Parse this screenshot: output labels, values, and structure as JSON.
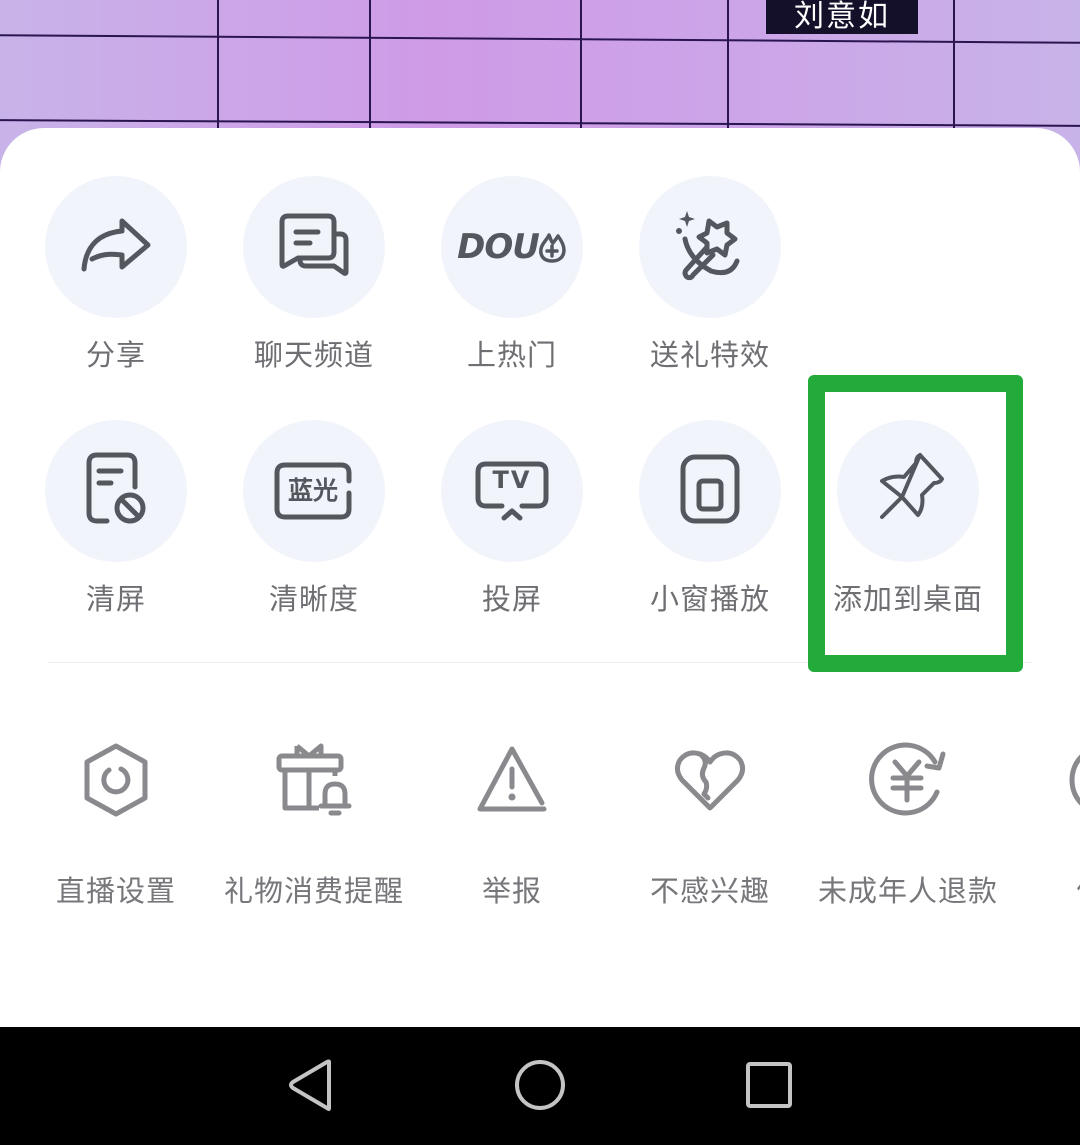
{
  "background": {
    "overlay_text": "刘意如"
  },
  "sheet": {
    "primary_actions": [
      {
        "label": "分享",
        "icon": "share-arrow-icon"
      },
      {
        "label": "聊天频道",
        "icon": "chat-bubbles-icon"
      },
      {
        "label": "上热门",
        "icon": "dou-plus-icon",
        "icon_text": "DOU"
      },
      {
        "label": "送礼特效",
        "icon": "magic-wand-star-icon"
      }
    ],
    "secondary_actions": [
      {
        "label": "清屏",
        "icon": "clear-screen-icon"
      },
      {
        "label": "清晰度",
        "icon": "resolution-badge-icon",
        "icon_text": "蓝光"
      },
      {
        "label": "投屏",
        "icon": "tv-cast-icon",
        "icon_text": "TV"
      },
      {
        "label": "小窗播放",
        "icon": "mini-window-icon"
      },
      {
        "label": "添加到桌面",
        "icon": "pin-icon",
        "highlighted": true
      }
    ],
    "tools": [
      {
        "label": "直播设置",
        "icon": "hexagon-settings-icon"
      },
      {
        "label": "礼物消费提醒",
        "icon": "gift-bell-icon"
      },
      {
        "label": "举报",
        "icon": "warning-triangle-icon"
      },
      {
        "label": "不感兴趣",
        "icon": "broken-heart-icon"
      },
      {
        "label": "未成年人退款",
        "icon": "yuan-refund-icon",
        "icon_text": "¥"
      },
      {
        "label": "优化",
        "icon": "partial-circle-icon"
      }
    ]
  },
  "colors": {
    "highlight": "#22ab3b",
    "icon_dark": "#55575e",
    "icon_gray": "#8a8a8e",
    "label": "#6e6e73",
    "circle_bg": "#f2f4fb"
  },
  "navbar": {
    "buttons": [
      "back",
      "home",
      "recents"
    ]
  }
}
